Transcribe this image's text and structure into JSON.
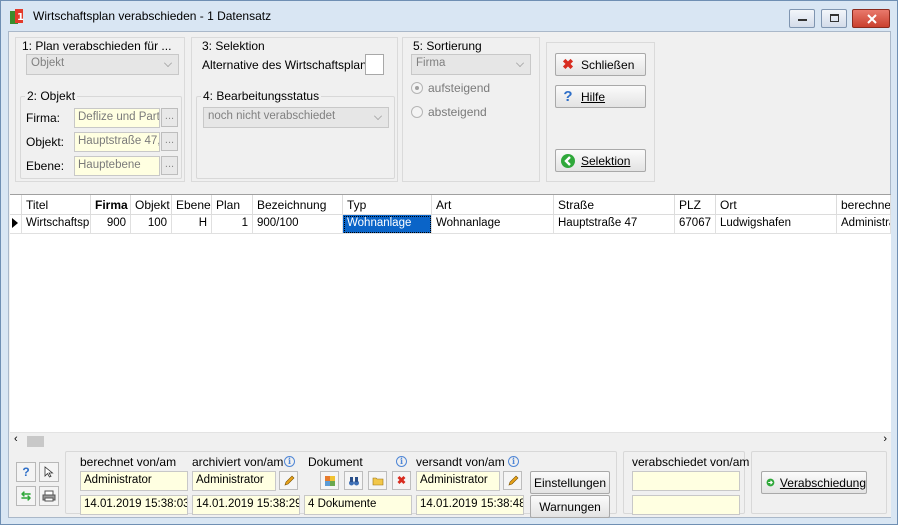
{
  "window": {
    "title": "Wirtschaftsplan verabschieden - 1 Datensatz"
  },
  "section1": {
    "label": "1: Plan verabschieden für ...",
    "combo_value": "Objekt"
  },
  "section2": {
    "label": "2: Objekt",
    "firma_label": "Firma:",
    "firma_value": "Deflize und Partr",
    "objekt_label": "Objekt:",
    "objekt_value": "Hauptstraße 47,",
    "ebene_label": "Ebene:",
    "ebene_value": "Hauptebene",
    "ellipsis": "..."
  },
  "section3": {
    "label": "3: Selektion",
    "alt_label": "Alternative des Wirtschaftsplans:",
    "alt_value": ""
  },
  "section4": {
    "label": "4: Bearbeitungsstatus",
    "combo_value": "noch nicht verabschiedet"
  },
  "section5": {
    "label": "5: Sortierung",
    "combo_value": "Firma",
    "asc_label": "aufsteigend",
    "desc_label": "absteigend"
  },
  "actions": {
    "close_label": "Schließen",
    "help_label": "Hilfe",
    "selection_label": "Selektion"
  },
  "table": {
    "headers": [
      "Titel",
      "Firma",
      "Objekt",
      "Ebene",
      "Plan",
      "Bezeichnung",
      "Typ",
      "Art",
      "Straße",
      "PLZ",
      "Ort",
      "berechnet"
    ],
    "rows": [
      [
        "Wirtschaftspl",
        "900",
        "100",
        "H",
        "1",
        "900/100",
        "Wohnanlage",
        "Wohnanlage",
        "Hauptstraße 47",
        "67067",
        "Ludwigshafen",
        "Administrat"
      ]
    ]
  },
  "footer": {
    "berechnet_label": "berechnet von/am",
    "berechnet_user": "Administrator",
    "berechnet_date": "14.01.2019 15:38:03",
    "archiviert_label": "archiviert von/am",
    "archiviert_user": "Administrator",
    "archiviert_date": "14.01.2019 15:38:29",
    "dokument_label": "Dokument",
    "dokument_value": "4 Dokumente",
    "versandt_label": "versandt von/am",
    "versandt_user": "Administrator",
    "versandt_date": "14.01.2019 15:38:48",
    "einstellungen_label": "Einstellungen",
    "warnungen_label": "Warnungen",
    "verabschiedet_label": "verabschiedet von/am",
    "verabschiedet_user": "",
    "verabschiedet_date": "",
    "verabschiedung_label": "Verabschiedung"
  },
  "colors": {
    "selection": "#0a64c8",
    "field_yellow": "#ffffe1",
    "title_bg": "#d9e6f3",
    "close_red": "#c9402e"
  }
}
